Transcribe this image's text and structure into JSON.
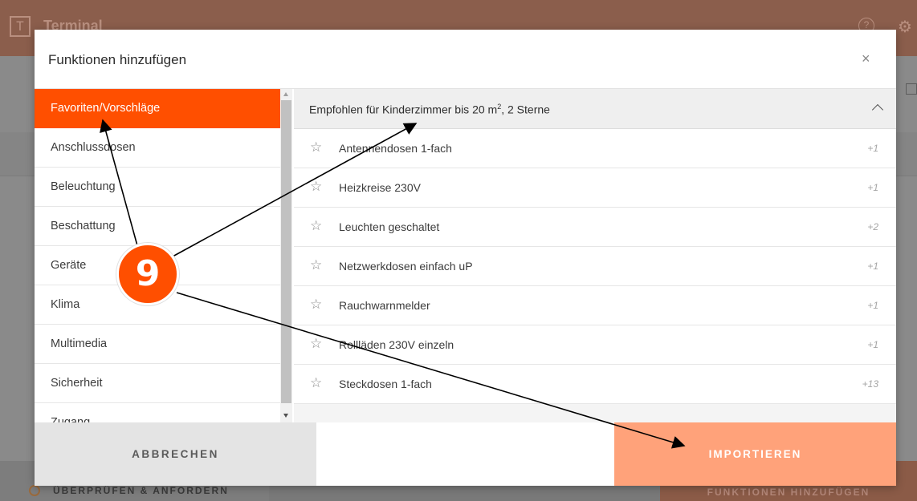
{
  "app": {
    "logo": "T",
    "title": "Terminal",
    "help_glyph": "?",
    "gear_glyph": "⚙",
    "review_label": "ÜBERPRÜFEN & ANFORDERN",
    "add_functions_label": "FUNKTIONEN HINZUFÜGEN"
  },
  "modal": {
    "title": "Funktionen hinzufügen",
    "close_glyph": "×",
    "categories": [
      {
        "label": "Favoriten/Vorschläge",
        "active": true
      },
      {
        "label": "Anschlussdosen",
        "active": false
      },
      {
        "label": "Beleuchtung",
        "active": false
      },
      {
        "label": "Beschattung",
        "active": false
      },
      {
        "label": "Geräte",
        "active": false
      },
      {
        "label": "Klima",
        "active": false
      },
      {
        "label": "Multimedia",
        "active": false
      },
      {
        "label": "Sicherheit",
        "active": false
      },
      {
        "label": "Zugang",
        "active": false
      }
    ],
    "group": {
      "title_main": "Empfohlen für Kinderzimmer bis 20 m",
      "title_sup": "2",
      "title_rest": ", 2 Sterne"
    },
    "functions": [
      {
        "label": "Antennendosen 1-fach",
        "count": "+1"
      },
      {
        "label": "Heizkreise 230V",
        "count": "+1"
      },
      {
        "label": "Leuchten geschaltet",
        "count": "+2"
      },
      {
        "label": "Netzwerkdosen einfach uP",
        "count": "+1"
      },
      {
        "label": "Rauchwarnmelder",
        "count": "+1"
      },
      {
        "label": "Rollläden 230V einzeln",
        "count": "+1"
      },
      {
        "label": "Steckdosen 1-fach",
        "count": "+13"
      }
    ],
    "cancel_label": "ABBRECHEN",
    "import_label": "IMPORTIEREN"
  },
  "annotation": {
    "number": "9",
    "color": "#ff4f00"
  },
  "icons": {
    "star": "☆",
    "chevron": "chevron-up-icon"
  }
}
